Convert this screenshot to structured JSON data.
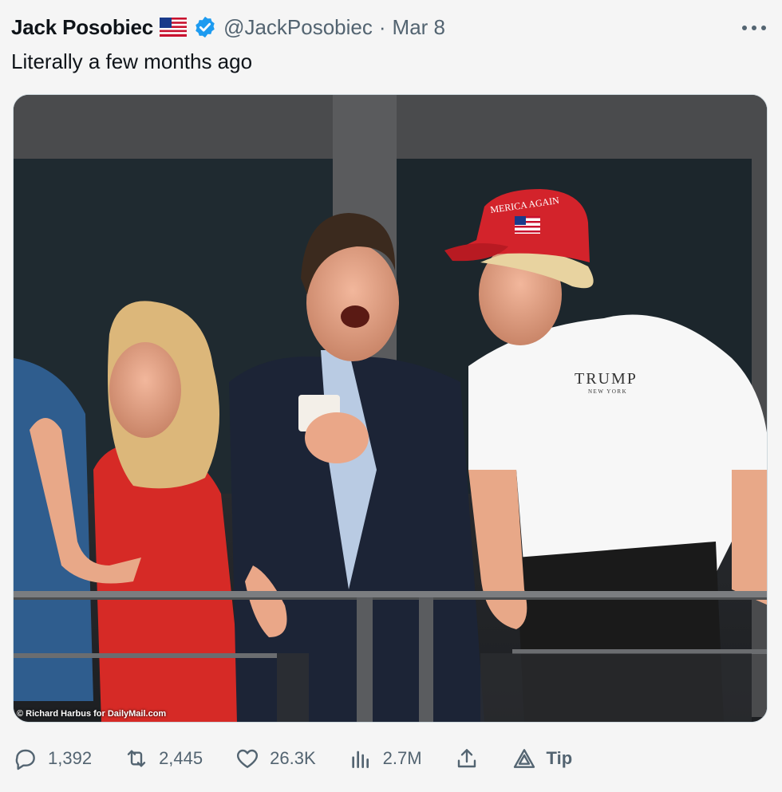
{
  "tweet": {
    "display_name": "Jack Posobiec",
    "handle": "@JackPosobiec",
    "separator": "·",
    "date": "Mar 8",
    "text": "Literally a few months ago",
    "media_credit": "© Richard Harbus for DailyMail.com",
    "cap_text": "MERICA AGAIN",
    "shirt_logo": "TRUMP",
    "shirt_logo_sub": "NEW YORK"
  },
  "actions": {
    "replies": "1,392",
    "retweets": "2,445",
    "likes": "26.3K",
    "views": "2.7M",
    "tip": "Tip"
  },
  "colors": {
    "accent": "#1d9bf0",
    "secondary_text": "#536471",
    "primary_text": "#0f1419"
  }
}
